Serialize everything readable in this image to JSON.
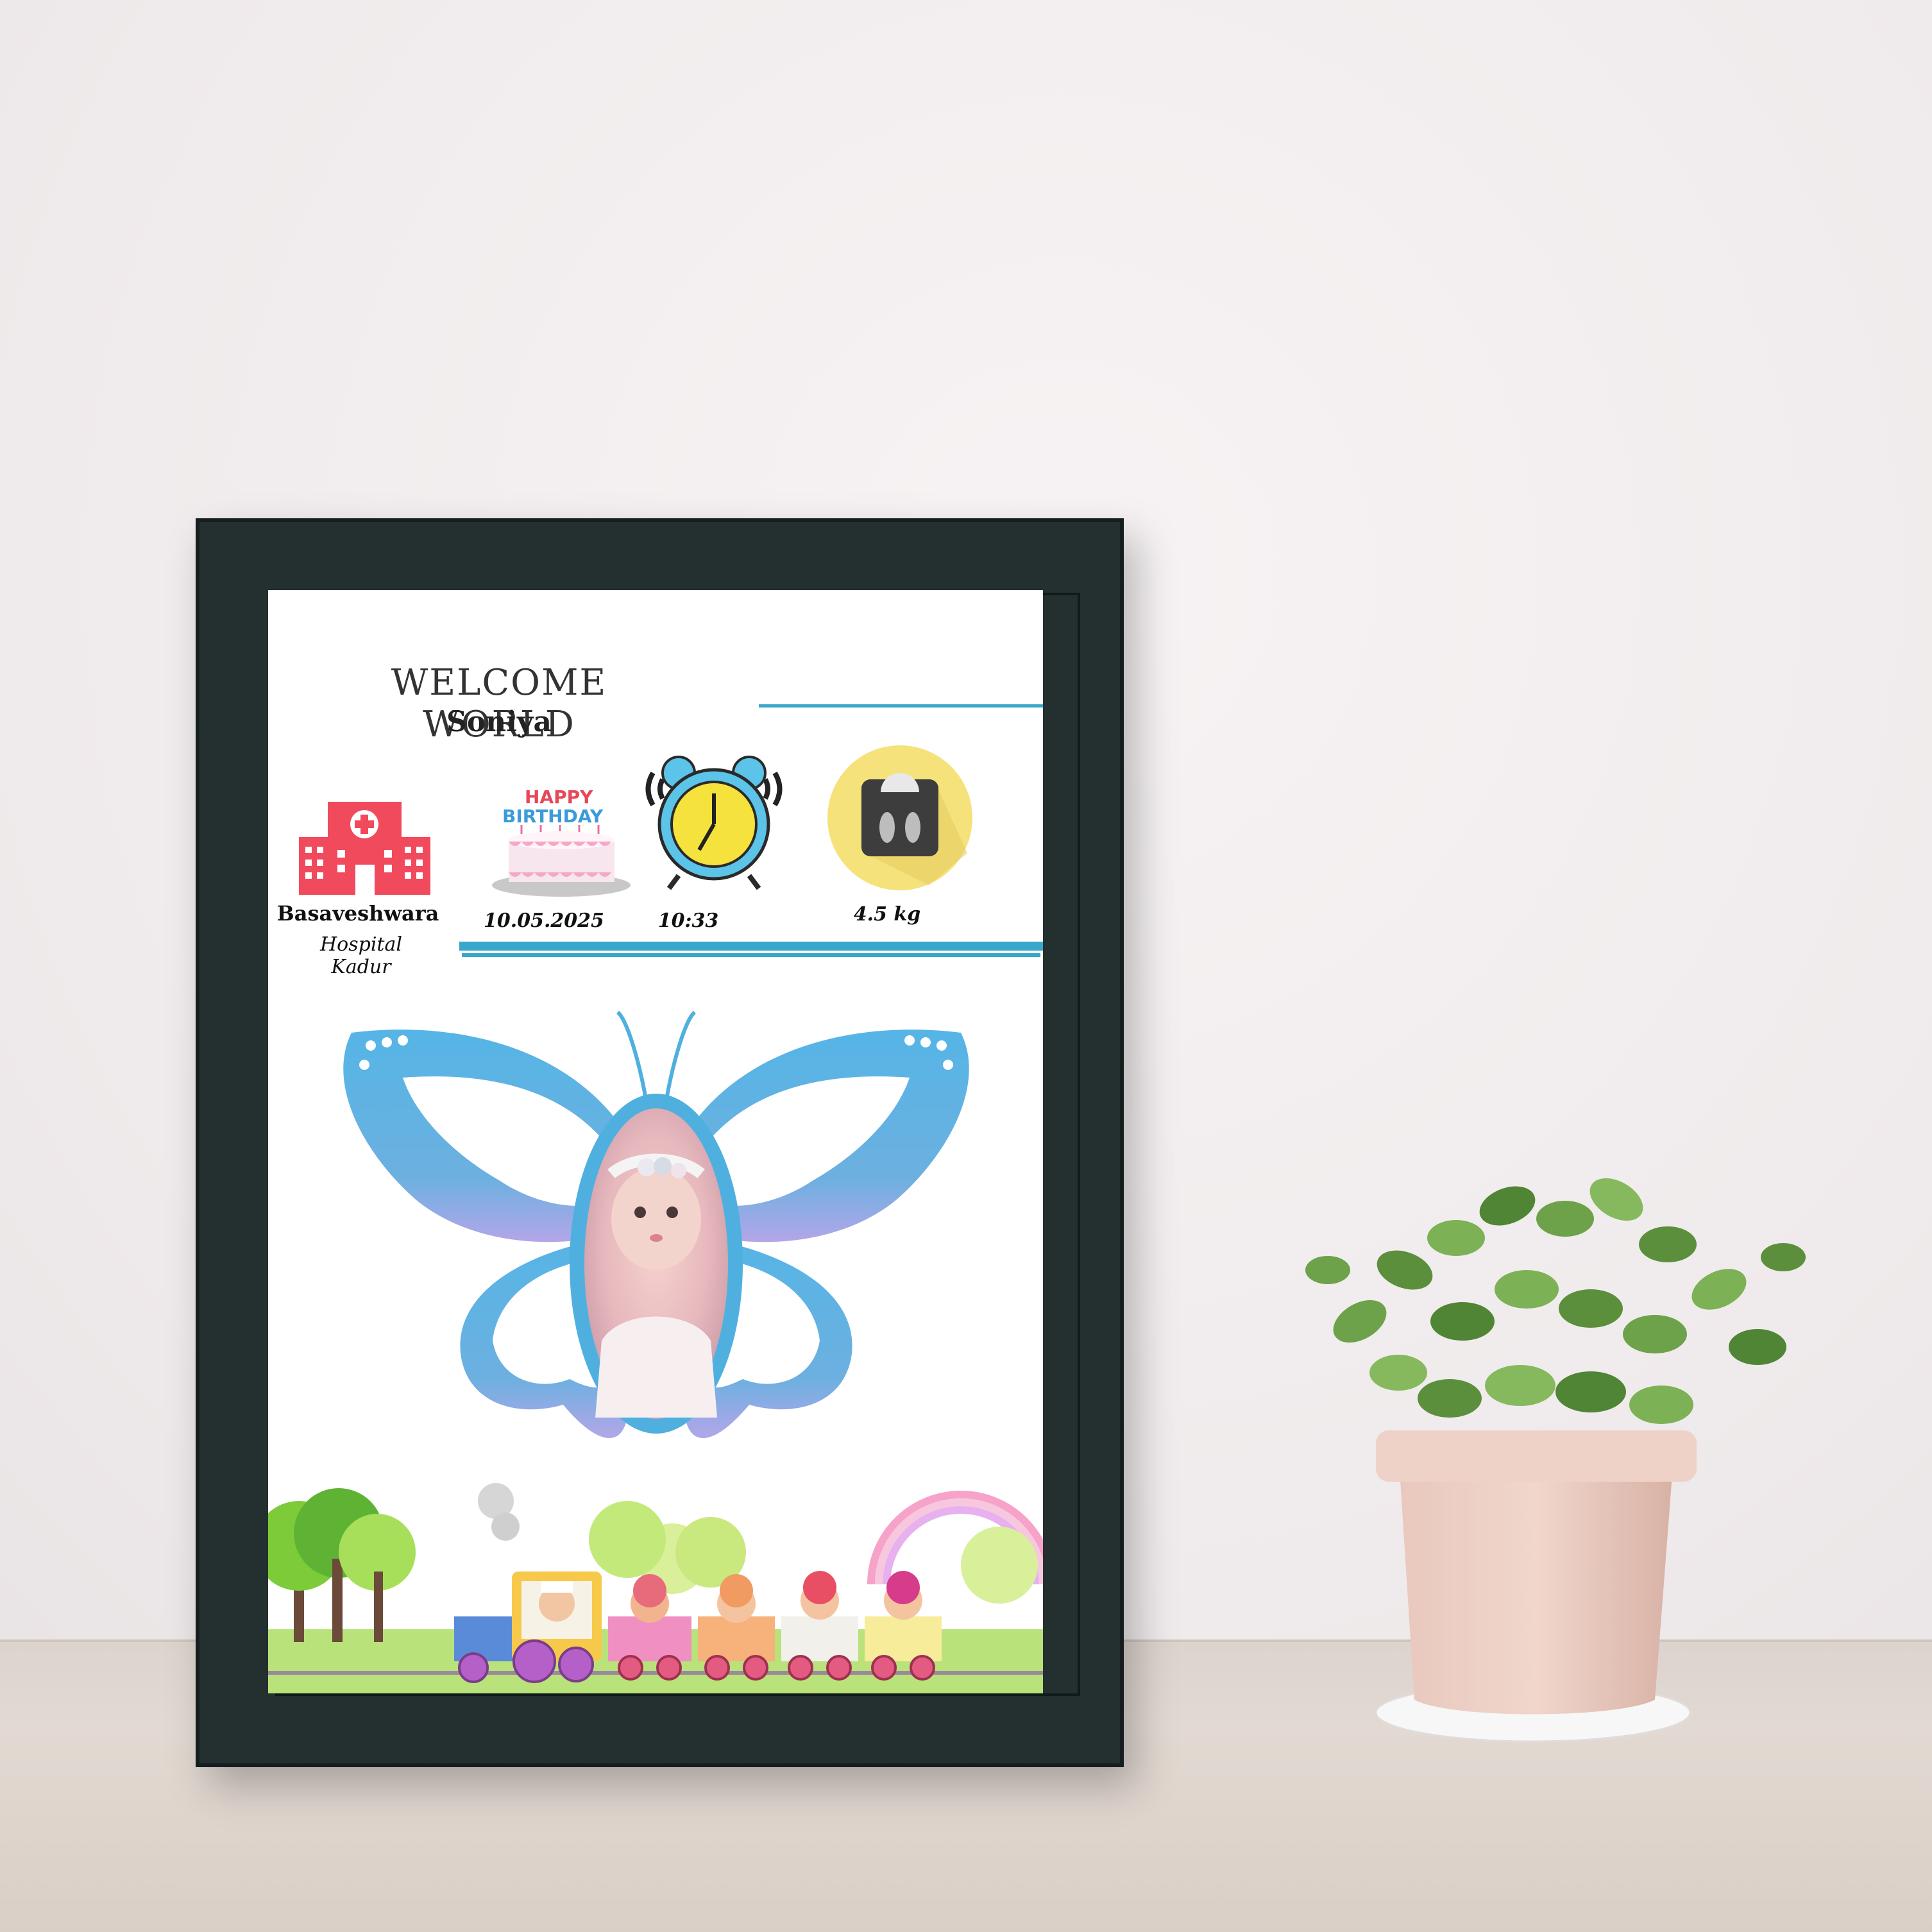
{
  "certificate": {
    "heading": "WELCOME WORLD",
    "baby_name": "Soniya",
    "hospital_name": "Basaveshwara",
    "hospital_location": "Hospital Kadur",
    "birth_date": "10.05.2025",
    "birth_time": "10:33",
    "birth_weight": "4.5 kg",
    "cake_text_top": "HAPPY",
    "cake_text_bottom": "BIRTHDAY"
  },
  "colors": {
    "accent_blue": "#39a6cc",
    "frame": "#243030",
    "hospital_red": "#f04a5c"
  },
  "icons": [
    "hospital-icon",
    "birthday-cake-icon",
    "alarm-clock-icon",
    "weighing-scale-icon",
    "butterfly-photo-frame",
    "train-scene",
    "potted-plant"
  ]
}
